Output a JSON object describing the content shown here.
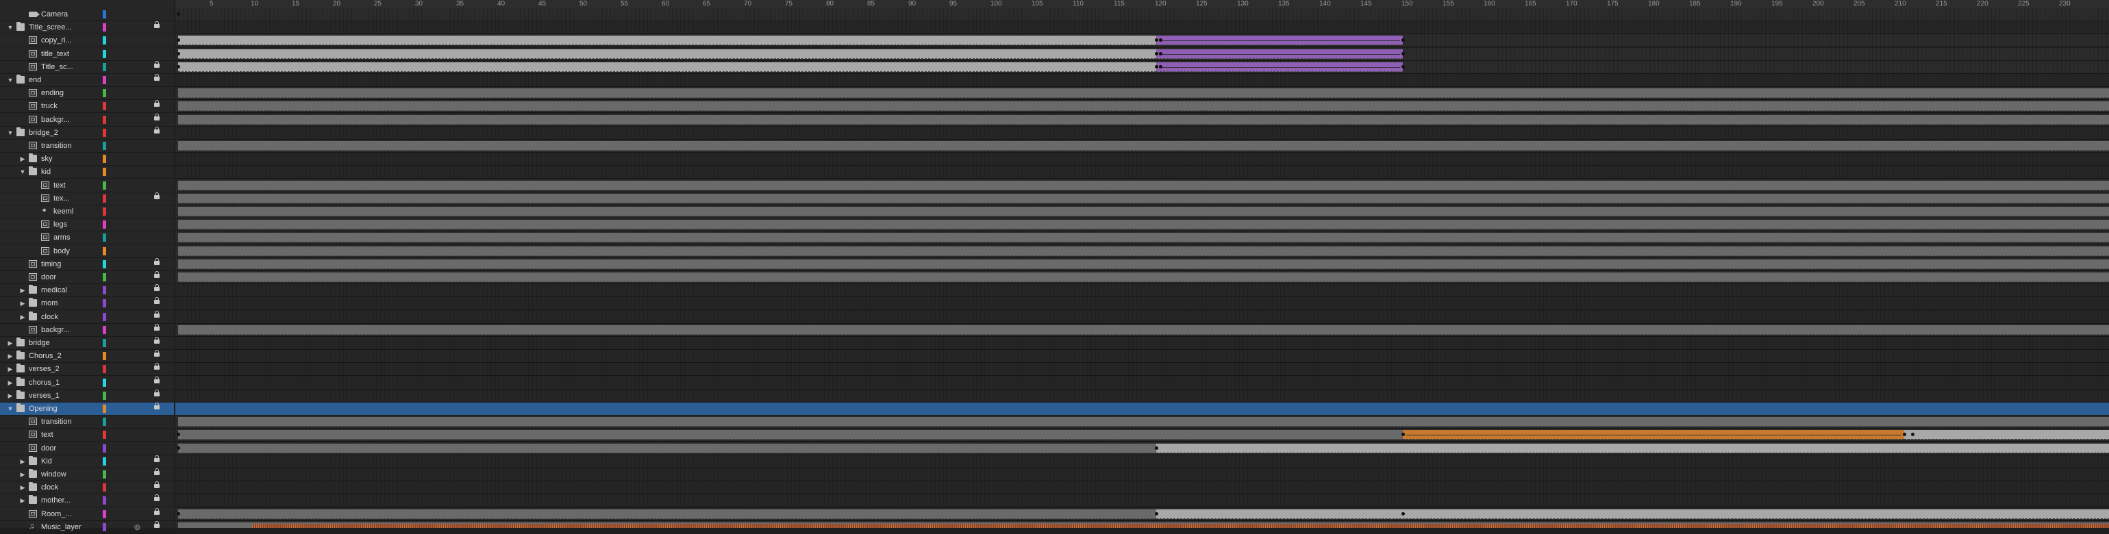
{
  "ruler": {
    "start_frame": 1,
    "tick_interval": 5,
    "labels": [
      "5",
      "10",
      "15",
      "20",
      "25",
      "30",
      "35",
      "40",
      "45",
      "50",
      "55",
      "60",
      "65",
      "70",
      "75",
      "80",
      "85",
      "90",
      "95",
      "100",
      "105",
      "110",
      "115",
      "120",
      "125",
      "130",
      "135",
      "140",
      "145",
      "150",
      "155",
      "160",
      "165",
      "170",
      "175",
      "180",
      "185",
      "190",
      "195",
      "200",
      "205",
      "210",
      "215",
      "220",
      "225",
      "230"
    ]
  },
  "colors": {
    "magenta": "#e040c8",
    "cyan": "#20d6e0",
    "red": "#e03838",
    "green": "#48b848",
    "orange": "#e88a24",
    "purple": "#9048d0",
    "teal": "#18a0a0",
    "blue": "#2878d8",
    "pink": "#e060a0",
    "yellow": "#e0c030"
  },
  "layers": [
    {
      "name": "Camera",
      "indent": 1,
      "type": "camera",
      "expand": "none",
      "color": "blue",
      "locked": false,
      "selected": false,
      "spans": [
        {
          "type": "kf",
          "frame": 1
        }
      ]
    },
    {
      "name": "Title_scree...",
      "indent": 0,
      "type": "folder",
      "expand": "open",
      "color": "magenta",
      "locked": true,
      "selected": false,
      "group": true,
      "spans": []
    },
    {
      "name": "copy_ri...",
      "indent": 1,
      "type": "drawing",
      "expand": "none",
      "color": "cyan",
      "locked": false,
      "selected": false,
      "spans": [
        {
          "type": "span",
          "start": 1,
          "end": 120,
          "style": "light"
        },
        {
          "type": "span",
          "start": 120,
          "end": 150,
          "style": "purple"
        },
        {
          "type": "kf",
          "frame": 1
        },
        {
          "type": "kf",
          "frame": 120
        },
        {
          "type": "kf",
          "frame": 120.5
        },
        {
          "type": "kf",
          "frame": 150
        }
      ]
    },
    {
      "name": "title_text",
      "indent": 1,
      "type": "drawing",
      "expand": "none",
      "color": "cyan",
      "locked": false,
      "selected": false,
      "spans": [
        {
          "type": "span",
          "start": 1,
          "end": 120,
          "style": "light"
        },
        {
          "type": "span",
          "start": 120,
          "end": 150,
          "style": "purple"
        },
        {
          "type": "kf",
          "frame": 1
        },
        {
          "type": "kf",
          "frame": 120
        },
        {
          "type": "kf",
          "frame": 120.5
        },
        {
          "type": "kf",
          "frame": 150
        }
      ]
    },
    {
      "name": "Title_sc...",
      "indent": 1,
      "type": "drawing",
      "expand": "none",
      "color": "teal",
      "locked": true,
      "selected": false,
      "spans": [
        {
          "type": "span",
          "start": 1,
          "end": 120,
          "style": "light"
        },
        {
          "type": "span",
          "start": 120,
          "end": 150,
          "style": "purple"
        },
        {
          "type": "kf",
          "frame": 1
        },
        {
          "type": "kf",
          "frame": 120
        },
        {
          "type": "kf",
          "frame": 120.5
        },
        {
          "type": "kf",
          "frame": 150
        }
      ]
    },
    {
      "name": "end",
      "indent": 0,
      "type": "folder",
      "expand": "open",
      "color": "magenta",
      "locked": true,
      "selected": false,
      "group": true,
      "spans": []
    },
    {
      "name": "ending",
      "indent": 1,
      "type": "drawing",
      "expand": "none",
      "color": "green",
      "locked": false,
      "selected": false,
      "spans": [
        {
          "type": "span",
          "start": 1,
          "end": 236,
          "style": "grey"
        }
      ]
    },
    {
      "name": "truck",
      "indent": 1,
      "type": "drawing",
      "expand": "none",
      "color": "red",
      "locked": true,
      "selected": false,
      "spans": [
        {
          "type": "span",
          "start": 1,
          "end": 236,
          "style": "grey"
        }
      ]
    },
    {
      "name": "backgr...",
      "indent": 1,
      "type": "drawing",
      "expand": "none",
      "color": "red",
      "locked": true,
      "selected": false,
      "spans": [
        {
          "type": "span",
          "start": 1,
          "end": 236,
          "style": "grey"
        }
      ]
    },
    {
      "name": "bridge_2",
      "indent": 0,
      "type": "folder",
      "expand": "open",
      "color": "red",
      "locked": true,
      "selected": false,
      "group": true,
      "spans": []
    },
    {
      "name": "transition",
      "indent": 1,
      "type": "drawing",
      "expand": "none",
      "color": "teal",
      "locked": false,
      "selected": false,
      "spans": [
        {
          "type": "span",
          "start": 1,
          "end": 236,
          "style": "grey"
        }
      ]
    },
    {
      "name": "sky",
      "indent": 1,
      "type": "folder",
      "expand": "closed",
      "color": "orange",
      "locked": false,
      "selected": false,
      "group": true,
      "spans": []
    },
    {
      "name": "kid",
      "indent": 1,
      "type": "folder",
      "expand": "open",
      "color": "orange",
      "locked": false,
      "selected": false,
      "group": true,
      "spans": []
    },
    {
      "name": "text",
      "indent": 2,
      "type": "drawing",
      "expand": "none",
      "color": "green",
      "locked": false,
      "selected": false,
      "spans": [
        {
          "type": "span",
          "start": 1,
          "end": 236,
          "style": "grey"
        }
      ]
    },
    {
      "name": "tex...",
      "indent": 2,
      "type": "drawing",
      "expand": "none",
      "color": "red",
      "locked": true,
      "selected": false,
      "spans": [
        {
          "type": "span",
          "start": 1,
          "end": 236,
          "style": "grey"
        }
      ]
    },
    {
      "name": "keeml",
      "indent": 2,
      "type": "bone",
      "expand": "none",
      "color": "red",
      "locked": false,
      "selected": false,
      "spans": [
        {
          "type": "span",
          "start": 1,
          "end": 236,
          "style": "grey"
        }
      ]
    },
    {
      "name": "legs",
      "indent": 2,
      "type": "drawing",
      "expand": "none",
      "color": "magenta",
      "locked": false,
      "selected": false,
      "spans": [
        {
          "type": "span",
          "start": 1,
          "end": 236,
          "style": "grey"
        }
      ]
    },
    {
      "name": "arms",
      "indent": 2,
      "type": "drawing",
      "expand": "none",
      "color": "teal",
      "locked": false,
      "selected": false,
      "spans": [
        {
          "type": "span",
          "start": 1,
          "end": 236,
          "style": "grey"
        }
      ]
    },
    {
      "name": "body",
      "indent": 2,
      "type": "drawing",
      "expand": "none",
      "color": "orange",
      "locked": false,
      "selected": false,
      "spans": [
        {
          "type": "span",
          "start": 1,
          "end": 236,
          "style": "grey"
        }
      ]
    },
    {
      "name": "timing",
      "indent": 1,
      "type": "drawing",
      "expand": "none",
      "color": "cyan",
      "locked": true,
      "selected": false,
      "spans": [
        {
          "type": "span",
          "start": 1,
          "end": 236,
          "style": "grey"
        }
      ]
    },
    {
      "name": "door",
      "indent": 1,
      "type": "drawing",
      "expand": "none",
      "color": "green",
      "locked": true,
      "selected": false,
      "spans": [
        {
          "type": "span",
          "start": 1,
          "end": 236,
          "style": "grey"
        }
      ]
    },
    {
      "name": "medical",
      "indent": 1,
      "type": "folder",
      "expand": "closed",
      "color": "purple",
      "locked": true,
      "selected": false,
      "group": true,
      "spans": []
    },
    {
      "name": "mom",
      "indent": 1,
      "type": "folder",
      "expand": "closed",
      "color": "purple",
      "locked": true,
      "selected": false,
      "group": true,
      "spans": []
    },
    {
      "name": "clock",
      "indent": 1,
      "type": "folder",
      "expand": "closed",
      "color": "purple",
      "locked": true,
      "selected": false,
      "group": true,
      "spans": []
    },
    {
      "name": "backgr...",
      "indent": 1,
      "type": "drawing",
      "expand": "none",
      "color": "magenta",
      "locked": true,
      "selected": false,
      "spans": [
        {
          "type": "span",
          "start": 1,
          "end": 236,
          "style": "grey"
        }
      ]
    },
    {
      "name": "bridge",
      "indent": 0,
      "type": "folder",
      "expand": "closed",
      "color": "teal",
      "locked": true,
      "selected": false,
      "group": true,
      "spans": []
    },
    {
      "name": "Chorus_2",
      "indent": 0,
      "type": "folder",
      "expand": "closed",
      "color": "orange",
      "locked": true,
      "selected": false,
      "group": true,
      "spans": []
    },
    {
      "name": "verses_2",
      "indent": 0,
      "type": "folder",
      "expand": "closed",
      "color": "red",
      "locked": true,
      "selected": false,
      "group": true,
      "spans": []
    },
    {
      "name": "chorus_1",
      "indent": 0,
      "type": "folder",
      "expand": "closed",
      "color": "cyan",
      "locked": true,
      "selected": false,
      "group": true,
      "spans": []
    },
    {
      "name": "verses_1",
      "indent": 0,
      "type": "folder",
      "expand": "closed",
      "color": "green",
      "locked": true,
      "selected": false,
      "group": true,
      "spans": []
    },
    {
      "name": "Opening",
      "indent": 0,
      "type": "folder",
      "expand": "open",
      "color": "orange",
      "locked": true,
      "selected": true,
      "group": true,
      "spans": []
    },
    {
      "name": "transition",
      "indent": 1,
      "type": "drawing",
      "expand": "none",
      "color": "teal",
      "locked": false,
      "selected": false,
      "spans": [
        {
          "type": "span",
          "start": 1,
          "end": 236,
          "style": "grey"
        }
      ]
    },
    {
      "name": "text",
      "indent": 1,
      "type": "drawing",
      "expand": "none",
      "color": "red",
      "locked": false,
      "selected": false,
      "spans": [
        {
          "type": "span",
          "start": 1,
          "end": 150,
          "style": "grey"
        },
        {
          "type": "span",
          "start": 150,
          "end": 211,
          "style": "orange"
        },
        {
          "type": "span",
          "start": 211,
          "end": 236,
          "style": "light"
        },
        {
          "type": "kf",
          "frame": 1
        },
        {
          "type": "kf",
          "frame": 150
        },
        {
          "type": "kf",
          "frame": 211
        },
        {
          "type": "kf",
          "frame": 212
        }
      ]
    },
    {
      "name": "door",
      "indent": 1,
      "type": "drawing",
      "expand": "none",
      "color": "purple",
      "locked": false,
      "selected": false,
      "spans": [
        {
          "type": "span",
          "start": 1,
          "end": 120,
          "style": "grey"
        },
        {
          "type": "span",
          "start": 120,
          "end": 236,
          "style": "light"
        },
        {
          "type": "kf",
          "frame": 1
        },
        {
          "type": "kf",
          "frame": 120
        }
      ]
    },
    {
      "name": "Kid",
      "indent": 1,
      "type": "folder",
      "expand": "closed",
      "color": "cyan",
      "locked": true,
      "selected": false,
      "group": true,
      "spans": []
    },
    {
      "name": "window",
      "indent": 1,
      "type": "folder",
      "expand": "closed",
      "color": "green",
      "locked": true,
      "selected": false,
      "group": true,
      "spans": []
    },
    {
      "name": "clock",
      "indent": 1,
      "type": "folder",
      "expand": "closed",
      "color": "red",
      "locked": true,
      "selected": false,
      "group": true,
      "spans": []
    },
    {
      "name": "mother...",
      "indent": 1,
      "type": "folder",
      "expand": "closed",
      "color": "purple",
      "locked": true,
      "selected": false,
      "group": true,
      "spans": []
    },
    {
      "name": "Room_...",
      "indent": 1,
      "type": "drawing",
      "expand": "none",
      "color": "magenta",
      "locked": true,
      "selected": false,
      "spans": [
        {
          "type": "span",
          "start": 1,
          "end": 120,
          "style": "grey"
        },
        {
          "type": "span",
          "start": 120,
          "end": 236,
          "style": "light"
        },
        {
          "type": "kf",
          "frame": 1
        },
        {
          "type": "kf",
          "frame": 120
        },
        {
          "type": "kf",
          "frame": 150
        }
      ]
    },
    {
      "name": "Music_layer",
      "indent": 1,
      "type": "audio",
      "expand": "none",
      "color": "purple",
      "locked": true,
      "hidden": true,
      "selected": false,
      "spans": [
        {
          "type": "span",
          "start": 1,
          "end": 236,
          "style": "grey"
        },
        {
          "type": "wave",
          "start": 10,
          "end": 236
        }
      ]
    }
  ]
}
